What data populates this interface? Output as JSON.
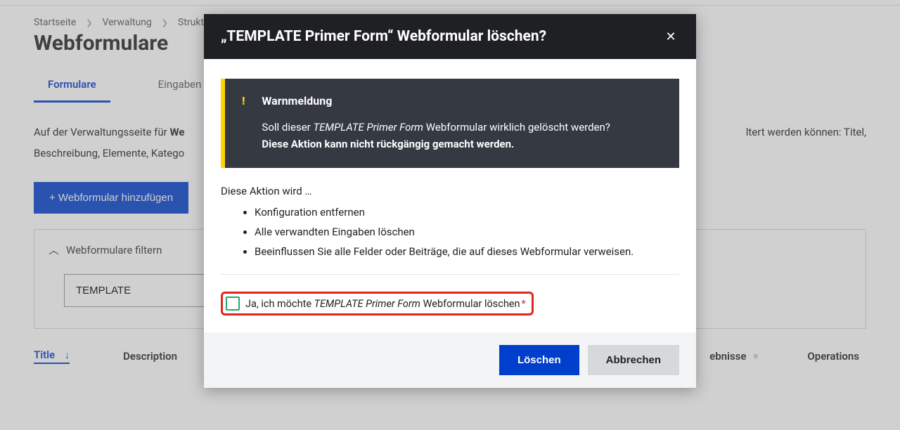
{
  "breadcrumbs": {
    "home": "Startseite",
    "admin": "Verwaltung",
    "struct": "Strukt"
  },
  "page": {
    "title": "Webformulare"
  },
  "tabs": {
    "forms": "Formulare",
    "entries": "Eingaben"
  },
  "intro": {
    "line1_prefix": "Auf der Verwaltungsseite für ",
    "line1_bold": "We",
    "line1_suffix": "ltert werden können: Titel,",
    "line2": "Beschreibung, Elemente, Katego"
  },
  "buttons": {
    "add_form": "+ Webformular hinzufügen"
  },
  "filter": {
    "header": "Webformulare filtern",
    "value": "TEMPLATE"
  },
  "table": {
    "title": "Title",
    "description": "Description",
    "results": "ebnisse",
    "operations": "Operations"
  },
  "modal": {
    "title": "„TEMPLATE Primer Form“ Webformular löschen?",
    "warn_title": "Warnmeldung",
    "warn_q_prefix": "Soll dieser ",
    "warn_q_em": "TEMPLATE Primer Form",
    "warn_q_suffix": " Webformular wirklich gelöscht werden?",
    "warn_irr": "Diese Aktion kann nicht rückgängig gemacht werden.",
    "action_intro": "Diese Aktion wird …",
    "action1": "Konfiguration entfernen",
    "action2": "Alle verwandten Eingaben löschen",
    "action3": "Beeinflussen Sie alle Felder oder Beiträge, die auf dieses Webformular verweisen.",
    "confirm_prefix": "Ja, ich möchte ",
    "confirm_em": "TEMPLATE Primer Form",
    "confirm_suffix": " Webformular löschen",
    "delete": "Löschen",
    "cancel": "Abbrechen"
  }
}
